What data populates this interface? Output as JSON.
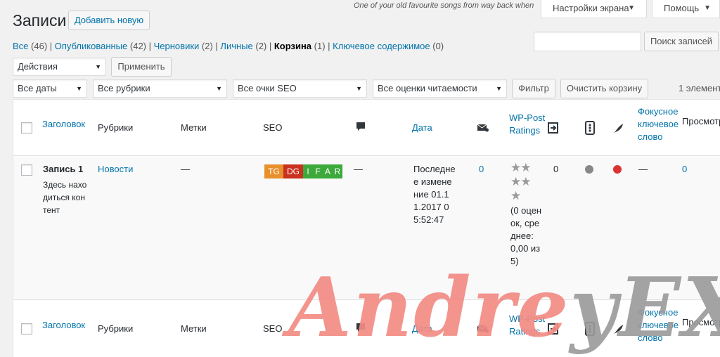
{
  "page": {
    "title": "Записи",
    "add_new": "Добавить новую",
    "hello_dolly": "One of your old favourite songs from way back when",
    "screen_options": "Настройки экрана",
    "help": "Помощь"
  },
  "views": [
    {
      "label": "Все",
      "count": "(46)"
    },
    {
      "label": "Опубликованные",
      "count": "(42)"
    },
    {
      "label": "Черновики",
      "count": "(2)"
    },
    {
      "label": "Личные",
      "count": "(2)"
    },
    {
      "label": "Корзина",
      "count": "(1)"
    },
    {
      "label": "Ключевое содержимое",
      "count": "(0)"
    }
  ],
  "search": {
    "button": "Поиск записей",
    "value": ""
  },
  "bulk": {
    "select": "Действия",
    "apply": "Применить"
  },
  "filters": {
    "dates": "Все даты",
    "categories": "Все рубрики",
    "seo_scores": "Все очки SEO",
    "readability": "Все оценки читаемости",
    "filter_button": "Фильтр",
    "empty_trash": "Очистить корзину",
    "items_count": "1 элемент"
  },
  "columns": {
    "title": "Заголовок",
    "categories": "Рубрики",
    "tags": "Метки",
    "seo": "SEO",
    "date": "Дата",
    "wp_postratings": "WP-PostRatings",
    "focus_keyword": "Фокусное ключевое слово",
    "views": "Просмотров"
  },
  "row": {
    "title": "Запись 1",
    "excerpt": "Здесь находиться контент",
    "category": "Новости",
    "tags": "—",
    "seo_badges": [
      {
        "label": "TG",
        "color": "#e8902c"
      },
      {
        "label": "DG",
        "color": "#c8321f"
      },
      {
        "label": "I",
        "color": "#3ca93a"
      },
      {
        "label": "F",
        "color": "#3ca93a"
      },
      {
        "label": "A",
        "color": "#3ca93a"
      },
      {
        "label": "R",
        "color": "#3ca93a"
      }
    ],
    "comments": "—",
    "date": "Последнее изменение 01.11.2017 05:52:47",
    "mail_count": "0",
    "ratings_count": "0 оценок",
    "ratings_avg": "0,00",
    "ratings_text": "(0 оценок, среднее: 0,00 из 5)",
    "linked_count": "0",
    "readability_color": "#888888",
    "seo_color": "#dc3232",
    "focus_keyword": "—",
    "views": "0"
  },
  "watermark": {
    "part1": "Andre",
    "part2": "yEX"
  }
}
